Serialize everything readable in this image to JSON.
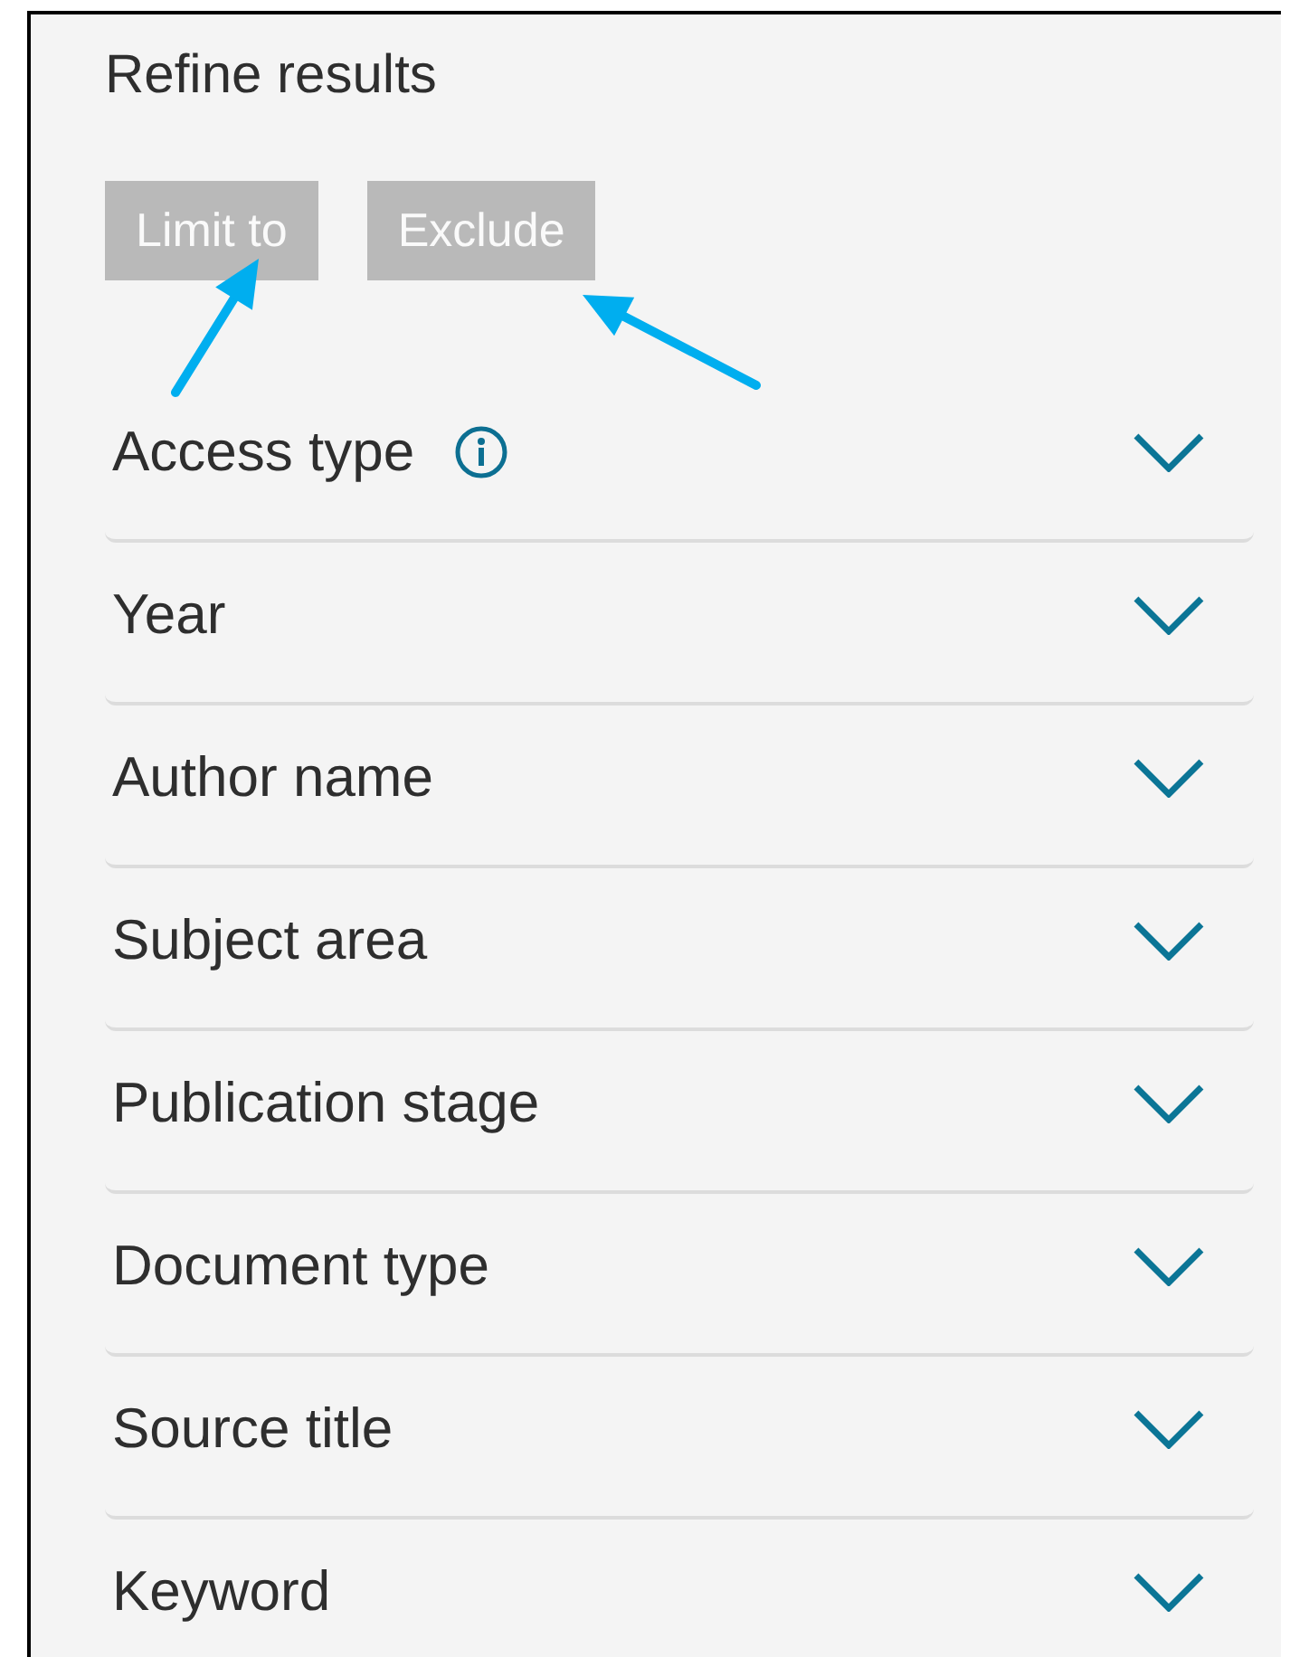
{
  "panel": {
    "title": "Refine results"
  },
  "buttons": [
    {
      "label": "Limit to",
      "disabled": true,
      "pointed_at": true
    },
    {
      "label": "Exclude",
      "disabled": true,
      "pointed_at": true
    }
  ],
  "filters": [
    {
      "label": "Access type",
      "info": true,
      "expanded": false
    },
    {
      "label": "Year",
      "info": false,
      "expanded": false
    },
    {
      "label": "Author name",
      "info": false,
      "expanded": false
    },
    {
      "label": "Subject area",
      "info": false,
      "expanded": false
    },
    {
      "label": "Publication stage",
      "info": false,
      "expanded": false
    },
    {
      "label": "Document type",
      "info": false,
      "expanded": false
    },
    {
      "label": "Source title",
      "info": false,
      "expanded": false
    },
    {
      "label": "Keyword",
      "info": false,
      "expanded": false
    }
  ]
}
